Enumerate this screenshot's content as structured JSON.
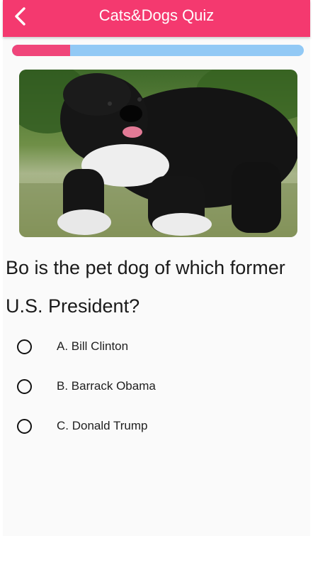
{
  "header": {
    "title": "Cats&Dogs Quiz",
    "back_icon": "chevron-left-icon",
    "color": "#f4396f"
  },
  "progress": {
    "fraction": 0.2,
    "fill_color": "#f0457a",
    "track_color": "#92c9f5"
  },
  "image": {
    "subject": "black and white curly-haired dog on grass"
  },
  "question": {
    "text": "Bo is the pet dog of which former U.S. President?"
  },
  "options": [
    {
      "label": "A. Bill Clinton"
    },
    {
      "label": "B. Barrack Obama"
    },
    {
      "label": "C. Donald Trump"
    }
  ]
}
